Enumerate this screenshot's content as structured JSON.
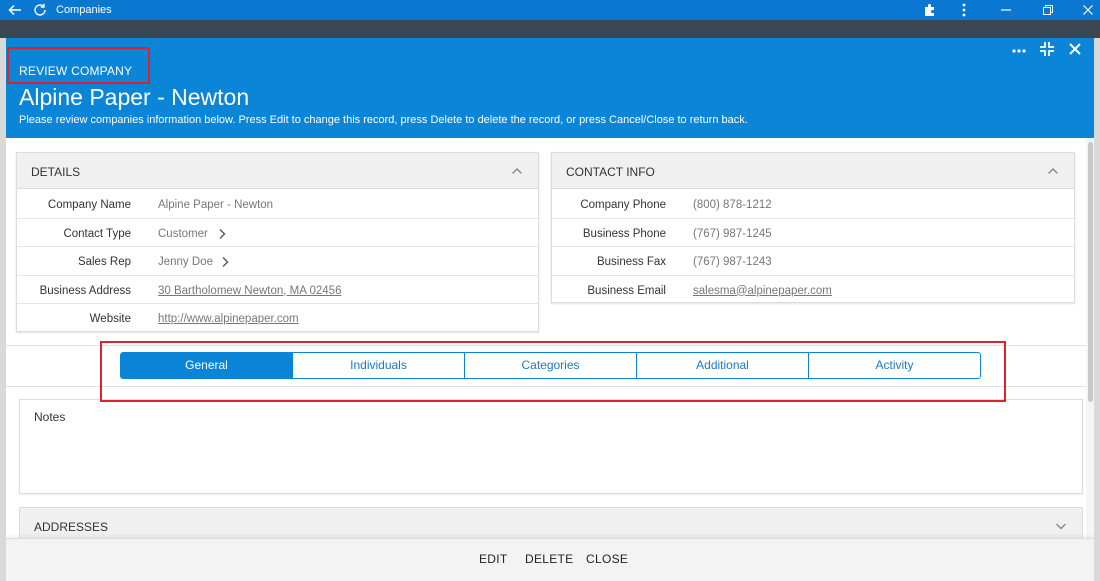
{
  "window": {
    "title": "Companies",
    "icons": [
      "back-arrow-icon",
      "refresh-icon",
      "puzzle-icon",
      "more-vertical-icon",
      "minimize-icon",
      "restore-icon",
      "close-icon"
    ]
  },
  "modal": {
    "kicker": "REVIEW COMPANY",
    "title": "Alpine Paper - Newton",
    "description": "Please review companies information below. Press Edit to change this record, press Delete to delete the record, or press Cancel/Close to return back.",
    "header_icons": [
      "more-horizontal-icon",
      "compress-icon",
      "close-icon"
    ]
  },
  "details": {
    "title": "DETAILS",
    "rows": [
      {
        "label": "Company Name",
        "value": "Alpine Paper - Newton"
      },
      {
        "label": "Contact Type",
        "value": "Customer"
      },
      {
        "label": "Sales Rep",
        "value": "Jenny Doe"
      },
      {
        "label": "Business Address",
        "value": "30 Bartholomew Newton, MA 02456"
      },
      {
        "label": "Website",
        "value": "http://www.alpinepaper.com"
      }
    ]
  },
  "contact": {
    "title": "CONTACT INFO",
    "rows": [
      {
        "label": "Company Phone",
        "value": "(800) 878-1212"
      },
      {
        "label": "Business Phone",
        "value": "(767) 987-1245"
      },
      {
        "label": "Business Fax",
        "value": "(767) 987-1243"
      },
      {
        "label": "Business Email",
        "value": "salesma@alpinepaper.com"
      }
    ]
  },
  "tabs": [
    {
      "label": "General",
      "active": true
    },
    {
      "label": "Individuals",
      "active": false
    },
    {
      "label": "Categories",
      "active": false
    },
    {
      "label": "Additional",
      "active": false
    },
    {
      "label": "Activity",
      "active": false
    }
  ],
  "notes": {
    "label": "Notes"
  },
  "addresses": {
    "title": "ADDRESSES"
  },
  "footer": {
    "edit": "EDIT",
    "delete": "DELETE",
    "close": "CLOSE"
  },
  "colors": {
    "accent": "#0a85d8",
    "titlebar": "#0a78d1",
    "highlight": "#d9232e"
  }
}
